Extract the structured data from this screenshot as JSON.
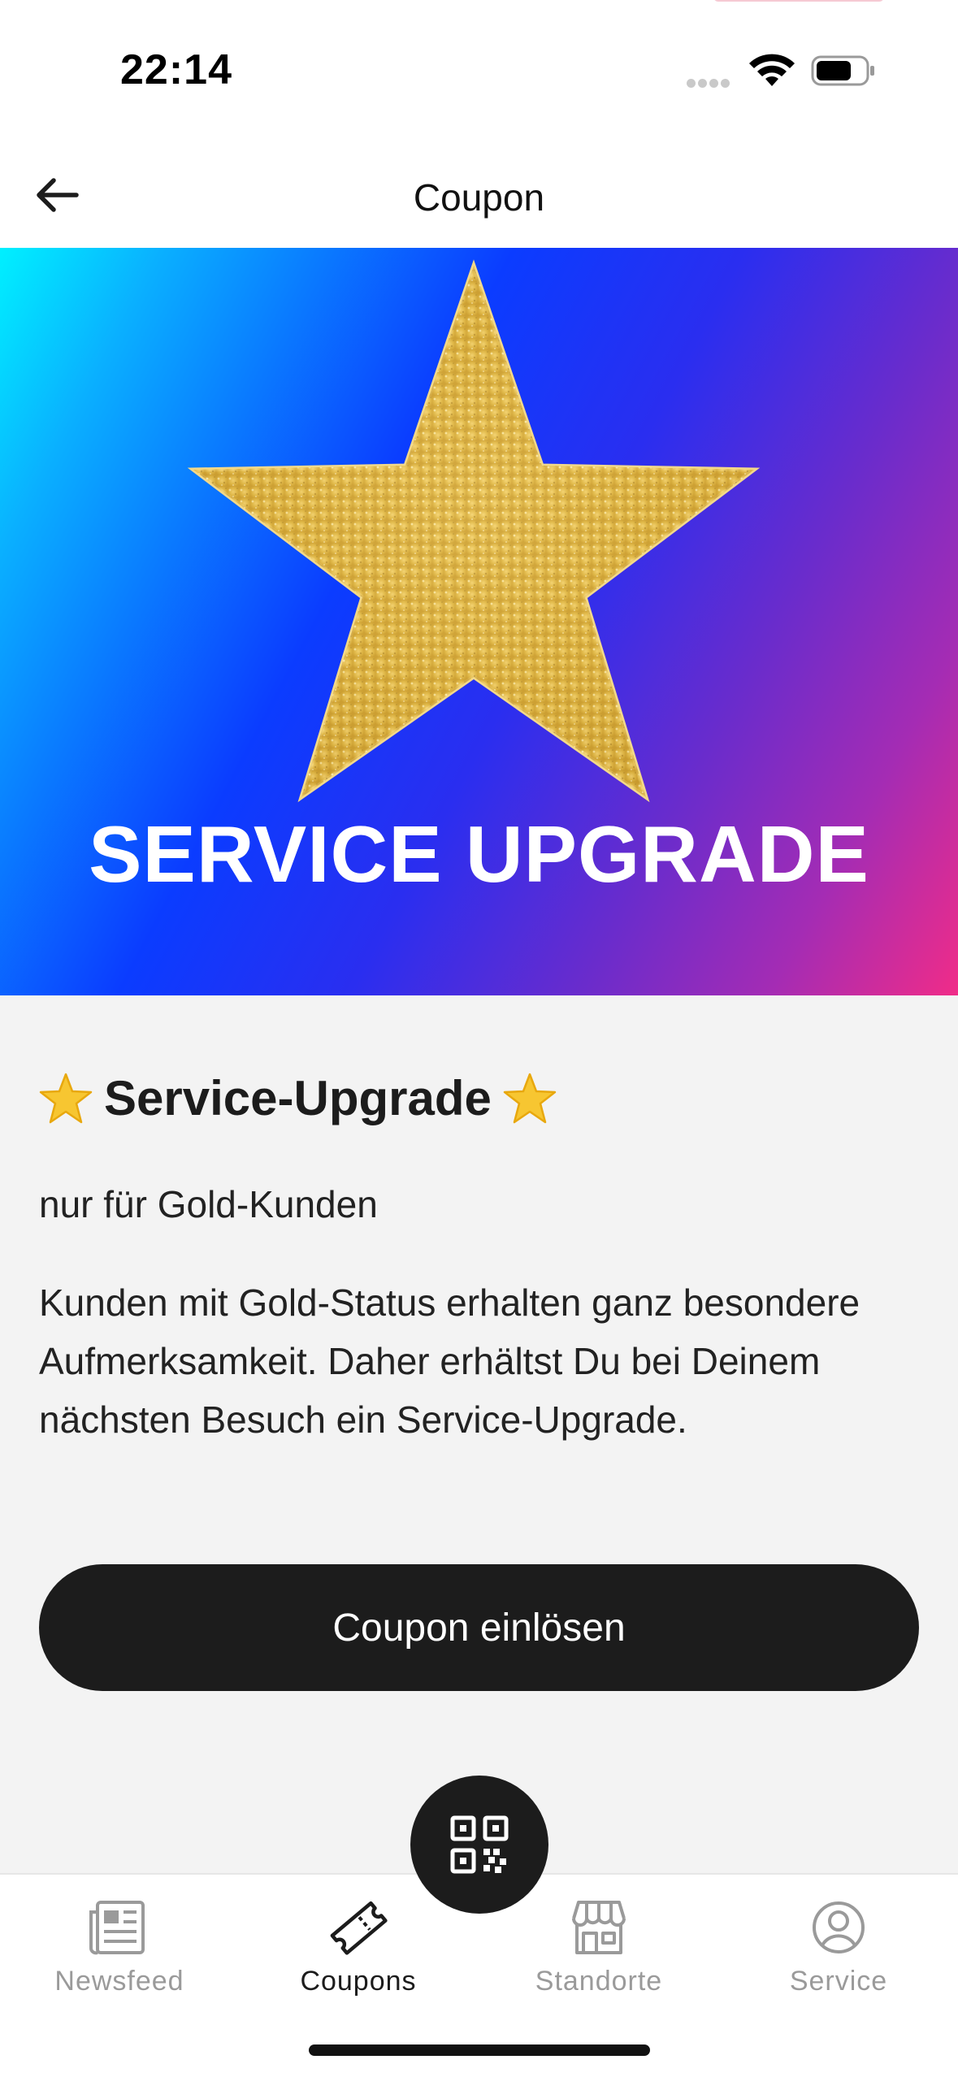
{
  "status_bar": {
    "time": "22:14"
  },
  "nav": {
    "title": "Coupon"
  },
  "hero": {
    "banner_text": "SERVICE UPGRADE"
  },
  "coupon": {
    "title": "Service-Upgrade",
    "subtitle": "nur für Gold-Kunden",
    "description": "Kunden mit Gold-Status erhalten ganz besondere Aufmerksamkeit. Daher erhältst Du bei Deinem nächsten Besuch ein Service-Upgrade.",
    "redeem_label": "Coupon einlösen"
  },
  "tabs": [
    {
      "label": "Newsfeed",
      "icon": "newspaper-icon",
      "active": false
    },
    {
      "label": "Coupons",
      "icon": "ticket-icon",
      "active": true
    },
    {
      "label": "Standorte",
      "icon": "store-icon",
      "active": false
    },
    {
      "label": "Service",
      "icon": "user-circle-icon",
      "active": false
    }
  ],
  "colors": {
    "primary_dark": "#1c1c1c",
    "gold": "#e0b848",
    "gradient_start": "#00f0ff",
    "gradient_mid": "#0b3cff",
    "gradient_end": "#f02c88"
  }
}
